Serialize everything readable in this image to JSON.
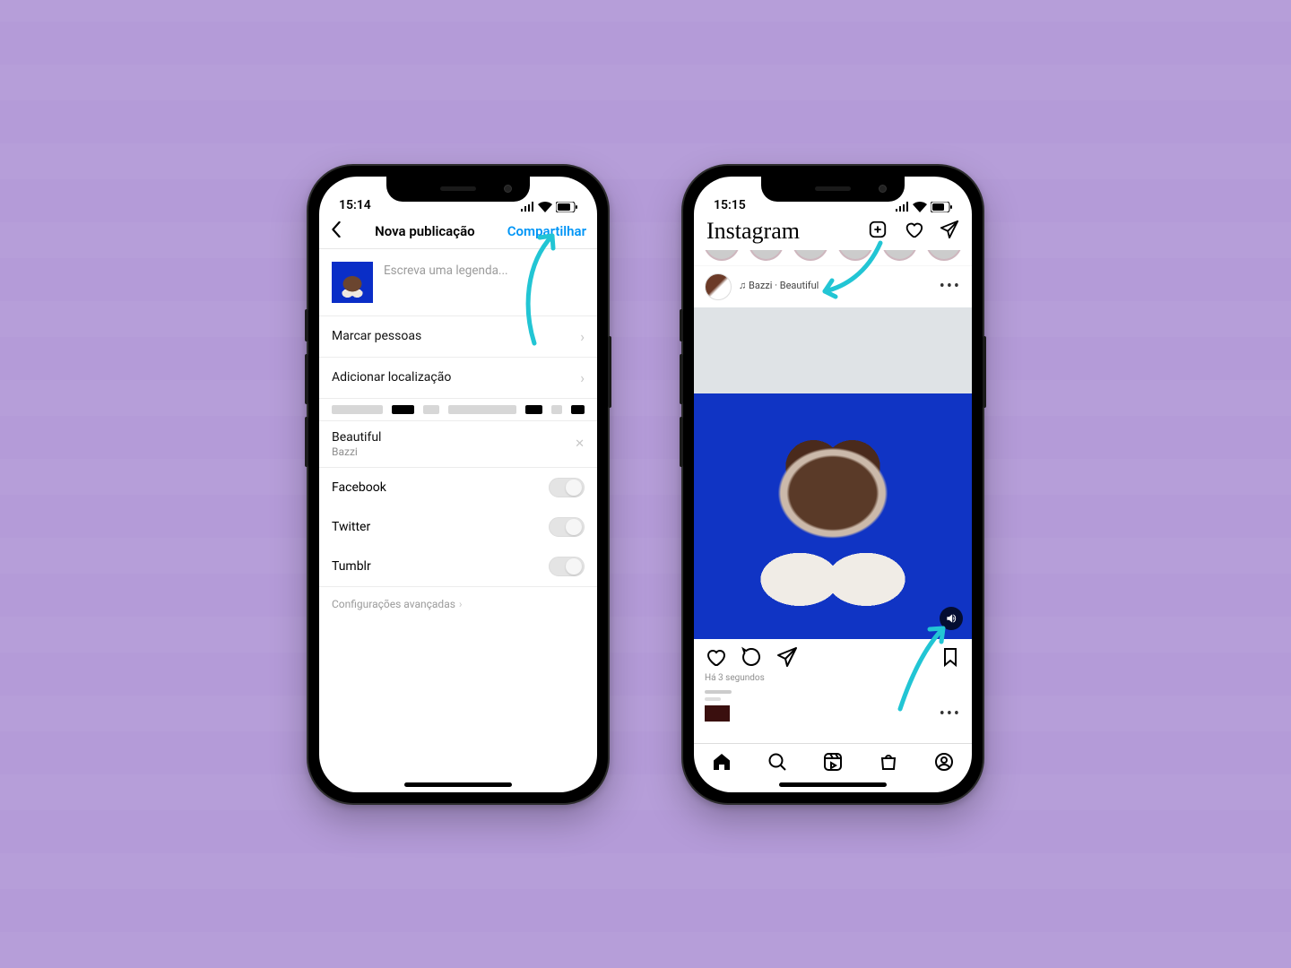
{
  "colors": {
    "accent": "#0095f6",
    "arrow": "#22c5d4",
    "bg": "#b49bd8"
  },
  "left": {
    "status_time": "15:14",
    "nav": {
      "title": "Nova publicação",
      "action": "Compartilhar"
    },
    "caption_placeholder": "Escreva uma legenda...",
    "rows": {
      "tag_people": "Marcar pessoas",
      "add_location": "Adicionar localização"
    },
    "music": {
      "title": "Beautiful",
      "artist": "Bazzi"
    },
    "share_targets": [
      {
        "label": "Facebook",
        "on": false
      },
      {
        "label": "Twitter",
        "on": false
      },
      {
        "label": "Tumblr",
        "on": false
      }
    ],
    "advanced": "Configurações avançadas"
  },
  "right": {
    "status_time": "15:15",
    "logo": "Instagram",
    "post": {
      "music_line": "Bazzi · Beautiful",
      "timestamp": "Há 3 segundos"
    },
    "icons": {
      "new_post": "plus-square-icon",
      "activity": "heart-icon",
      "messages": "send-icon",
      "home": "home-icon",
      "search": "search-icon",
      "reels": "reels-icon",
      "shop": "shop-icon",
      "profile": "profile-icon"
    }
  }
}
